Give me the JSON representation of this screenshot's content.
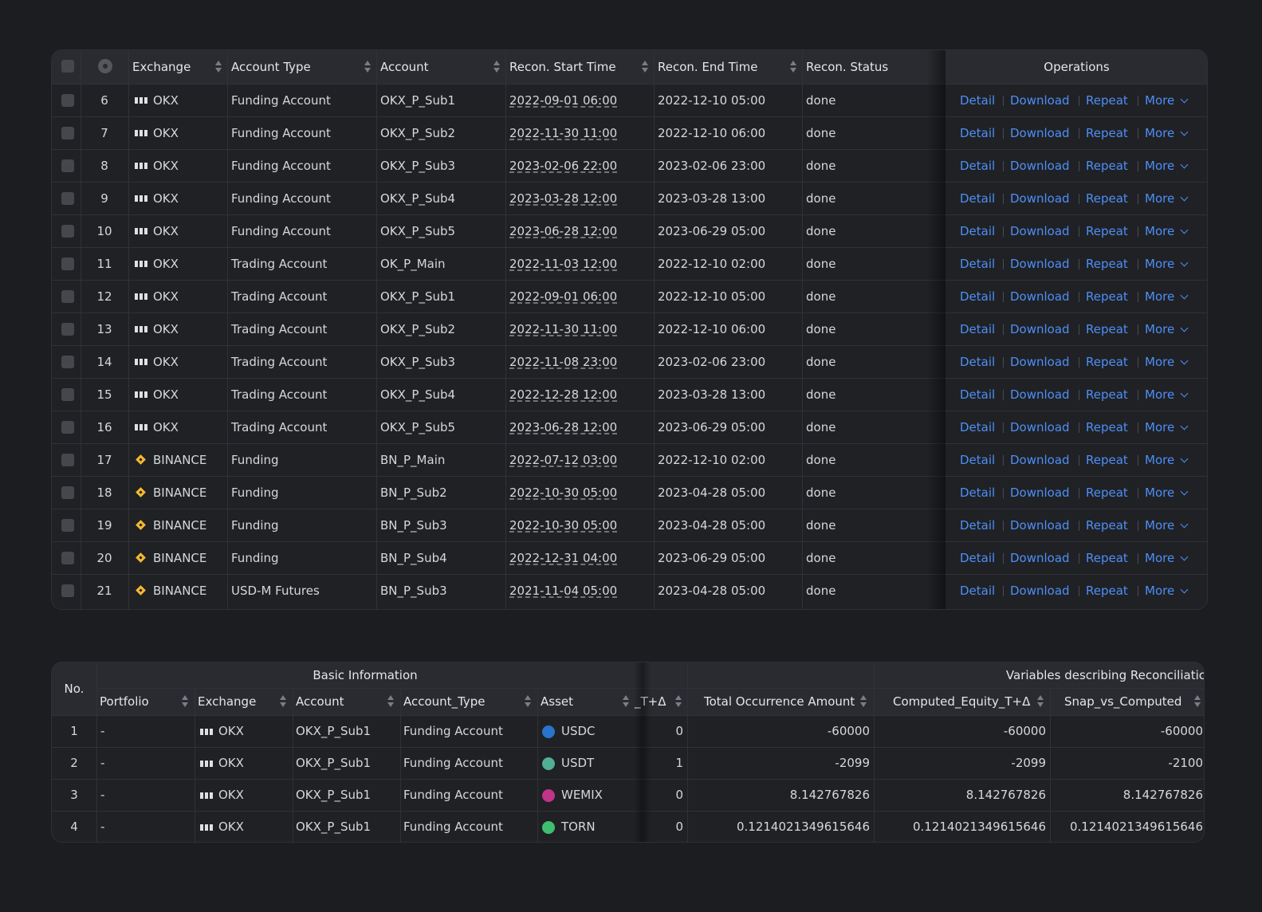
{
  "recon_table": {
    "headers": {
      "exchange": "Exchange",
      "account_type": "Account Type",
      "account": "Account",
      "start": "Recon. Start Time",
      "end": "Recon. End Time",
      "status": "Recon. Status",
      "operations": "Operations"
    },
    "op_labels": {
      "detail": "Detail",
      "download": "Download",
      "repeat": "Repeat",
      "more": "More"
    },
    "rows": [
      {
        "no": "6",
        "exchange": "OKX",
        "logo": "okx-logo",
        "type": "Funding Account",
        "account": "OKX_P_Sub1",
        "start": "2022-09-01 06:00",
        "end": "2022-12-10 05:00",
        "status": "done"
      },
      {
        "no": "7",
        "exchange": "OKX",
        "logo": "okx-logo",
        "type": "Funding Account",
        "account": "OKX_P_Sub2",
        "start": "2022-11-30 11:00",
        "end": "2022-12-10 06:00",
        "status": "done"
      },
      {
        "no": "8",
        "exchange": "OKX",
        "logo": "okx-logo",
        "type": "Funding Account",
        "account": "OKX_P_Sub3",
        "start": "2023-02-06 22:00",
        "end": "2023-02-06 23:00",
        "status": "done"
      },
      {
        "no": "9",
        "exchange": "OKX",
        "logo": "okx-logo",
        "type": "Funding Account",
        "account": "OKX_P_Sub4",
        "start": "2023-03-28 12:00",
        "end": "2023-03-28 13:00",
        "status": "done"
      },
      {
        "no": "10",
        "exchange": "OKX",
        "logo": "okx-logo",
        "type": "Funding Account",
        "account": "OKX_P_Sub5",
        "start": "2023-06-28 12:00",
        "end": "2023-06-29 05:00",
        "status": "done"
      },
      {
        "no": "11",
        "exchange": "OKX",
        "logo": "okx-logo",
        "type": "Trading Account",
        "account": "OK_P_Main",
        "start": "2022-11-03 12:00",
        "end": "2022-12-10 02:00",
        "status": "done"
      },
      {
        "no": "12",
        "exchange": "OKX",
        "logo": "okx-logo",
        "type": "Trading Account",
        "account": "OKX_P_Sub1",
        "start": "2022-09-01 06:00",
        "end": "2022-12-10 05:00",
        "status": "done"
      },
      {
        "no": "13",
        "exchange": "OKX",
        "logo": "okx-logo",
        "type": "Trading Account",
        "account": "OKX_P_Sub2",
        "start": "2022-11-30 11:00",
        "end": "2022-12-10 06:00",
        "status": "done"
      },
      {
        "no": "14",
        "exchange": "OKX",
        "logo": "okx-logo",
        "type": "Trading Account",
        "account": "OKX_P_Sub3",
        "start": "2022-11-08 23:00",
        "end": "2023-02-06 23:00",
        "status": "done"
      },
      {
        "no": "15",
        "exchange": "OKX",
        "logo": "okx-logo",
        "type": "Trading Account",
        "account": "OKX_P_Sub4",
        "start": "2022-12-28 12:00",
        "end": "2023-03-28 13:00",
        "status": "done"
      },
      {
        "no": "16",
        "exchange": "OKX",
        "logo": "okx-logo",
        "type": "Trading Account",
        "account": "OKX_P_Sub5",
        "start": "2023-06-28 12:00",
        "end": "2023-06-29 05:00",
        "status": "done"
      },
      {
        "no": "17",
        "exchange": "BINANCE",
        "logo": "binance-logo",
        "type": "Funding",
        "account": "BN_P_Main",
        "start": "2022-07-12 03:00",
        "end": "2022-12-10 02:00",
        "status": "done"
      },
      {
        "no": "18",
        "exchange": "BINANCE",
        "logo": "binance-logo",
        "type": "Funding",
        "account": "BN_P_Sub2",
        "start": "2022-10-30 05:00",
        "end": "2023-04-28 05:00",
        "status": "done"
      },
      {
        "no": "19",
        "exchange": "BINANCE",
        "logo": "binance-logo",
        "type": "Funding",
        "account": "BN_P_Sub3",
        "start": "2022-10-30 05:00",
        "end": "2023-04-28 05:00",
        "status": "done"
      },
      {
        "no": "20",
        "exchange": "BINANCE",
        "logo": "binance-logo",
        "type": "Funding",
        "account": "BN_P_Sub4",
        "start": "2022-12-31 04:00",
        "end": "2023-06-29 05:00",
        "status": "done"
      },
      {
        "no": "21",
        "exchange": "BINANCE",
        "logo": "binance-logo",
        "type": "USD-M Futures",
        "account": "BN_P_Sub3",
        "start": "2021-11-04 05:00",
        "end": "2023-04-28 05:00",
        "status": "done"
      }
    ]
  },
  "detail_table": {
    "group_headers": {
      "no": "No.",
      "basic": "Basic Information",
      "variables": "Variables describing Reconciliatic"
    },
    "headers": {
      "portfolio": "Portfolio",
      "exchange": "Exchange",
      "account": "Account",
      "account_type": "Account_Type",
      "asset": "Asset",
      "t_delta": "_T+Δ",
      "total": "Total Occurrence Amount",
      "equity": "Computed_Equity_T+Δ",
      "snap": "Snap_vs_Computed"
    },
    "rows": [
      {
        "no": "1",
        "portfolio": "-",
        "exchange": "OKX",
        "account": "OKX_P_Sub1",
        "type": "Funding Account",
        "asset": "USDC",
        "asset_icon": "usdc-icon",
        "asset_color": "#2775ca",
        "t": "0",
        "total": "-60000",
        "equity": "-60000",
        "snap": "-60000"
      },
      {
        "no": "2",
        "portfolio": "-",
        "exchange": "OKX",
        "account": "OKX_P_Sub1",
        "type": "Funding Account",
        "asset": "USDT",
        "asset_icon": "usdt-icon",
        "asset_color": "#50af95",
        "t": "1",
        "total": "-2099",
        "equity": "-2099",
        "snap": "-2100"
      },
      {
        "no": "3",
        "portfolio": "-",
        "exchange": "OKX",
        "account": "OKX_P_Sub1",
        "type": "Funding Account",
        "asset": "WEMIX",
        "asset_icon": "wemix-icon",
        "asset_color": "#c2338a",
        "t": "0",
        "total": "8.142767826",
        "equity": "8.142767826",
        "snap": "8.142767826"
      },
      {
        "no": "4",
        "portfolio": "-",
        "exchange": "OKX",
        "account": "OKX_P_Sub1",
        "type": "Funding Account",
        "asset": "TORN",
        "asset_icon": "torn-icon",
        "asset_color": "#3fbe72",
        "t": "0",
        "total": "0.1214021349615646",
        "equity": "0.1214021349615646",
        "snap": "0.1214021349615646"
      }
    ]
  }
}
